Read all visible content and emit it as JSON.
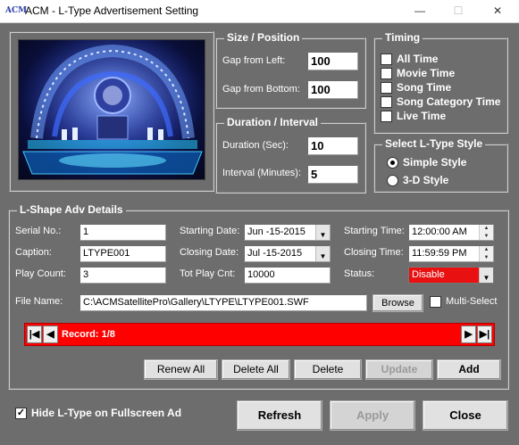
{
  "window": {
    "app_icon": "ACM",
    "title": "ACM - L-Type Advertisement Setting",
    "minimize": "—",
    "maximize": "☐",
    "close": "✕"
  },
  "size_position": {
    "legend": "Size / Position",
    "gap_left_label": "Gap from Left:",
    "gap_left_value": "100",
    "gap_bottom_label": "Gap from Bottom:",
    "gap_bottom_value": "100"
  },
  "duration_interval": {
    "legend": "Duration / Interval",
    "duration_label": "Duration (Sec):",
    "duration_value": "10",
    "interval_label": "Interval (Minutes):",
    "interval_value": "5"
  },
  "timing": {
    "legend": "Timing",
    "options": [
      {
        "label": "All Time",
        "checked": false
      },
      {
        "label": "Movie Time",
        "checked": false
      },
      {
        "label": "Song Time",
        "checked": false
      },
      {
        "label": "Song Category Time",
        "checked": false
      },
      {
        "label": "Live Time",
        "checked": false
      }
    ]
  },
  "style": {
    "legend": "Select L-Type Style",
    "options": [
      {
        "label": "Simple Style",
        "selected": true
      },
      {
        "label": "3-D Style",
        "selected": false
      }
    ]
  },
  "details": {
    "legend": "L-Shape Adv Details",
    "serial_label": "Serial No.:",
    "serial_value": "1",
    "caption_label": "Caption:",
    "caption_value": "LTYPE001",
    "play_count_label": "Play Count:",
    "play_count_value": "3",
    "start_date_label": "Starting Date:",
    "start_date_value": "Jun -15-2015",
    "close_date_label": "Closing Date:",
    "close_date_value": "Jul -15-2015",
    "tot_play_label": "Tot Play Cnt:",
    "tot_play_value": "10000",
    "start_time_label": "Starting Time:",
    "start_time_value": "12:00:00 AM",
    "close_time_label": "Closing Time:",
    "close_time_value": "11:59:59 PM",
    "status_label": "Status:",
    "status_value": "Disable",
    "file_label": "File Name:",
    "file_value": "C:\\ACMSatellitePro\\Gallery\\LTYPE\\LTYPE001.SWF",
    "browse_label": "Browse",
    "multiselect_label": "Multi-Select",
    "record_text": "Record: 1/8"
  },
  "actions": {
    "renew_all": "Renew All",
    "delete_all": "Delete All",
    "delete": "Delete",
    "update": "Update",
    "add": "Add"
  },
  "footer": {
    "hide_label": "Hide L-Type on Fullscreen Ad",
    "hide_checked": true,
    "refresh": "Refresh",
    "apply": "Apply",
    "close": "Close"
  },
  "colors": {
    "background": "#6d6d6d",
    "record_bar": "#ff0000",
    "status_disable": "#e81010"
  }
}
